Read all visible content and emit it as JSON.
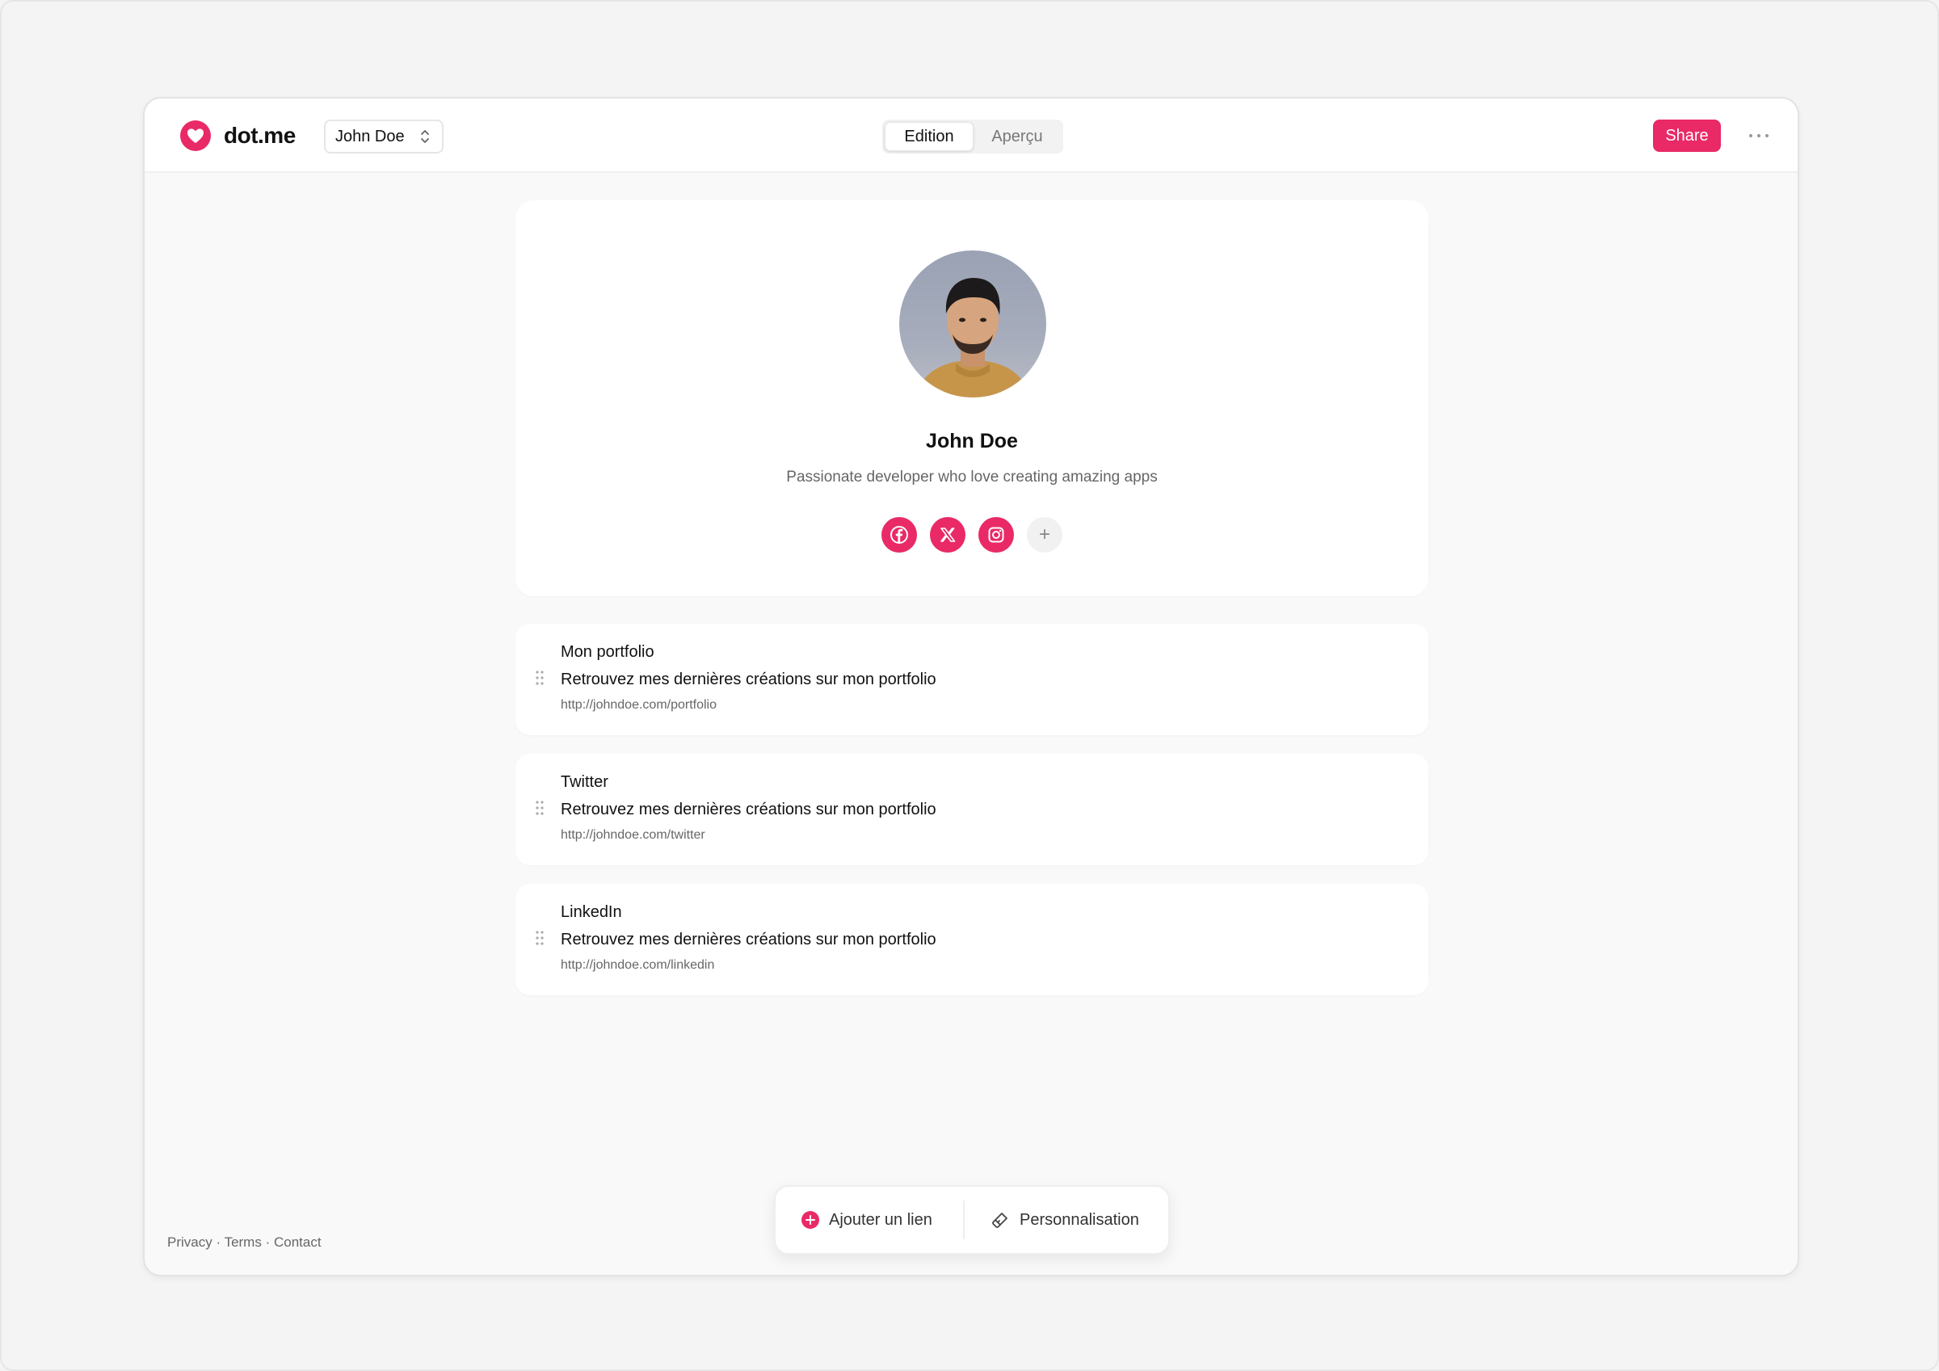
{
  "brand": {
    "name": "dot.me",
    "accent": "#e92a67"
  },
  "header": {
    "profile_select": "John Doe",
    "tabs": [
      {
        "label": "Edition",
        "active": true
      },
      {
        "label": "Aperçu",
        "active": false
      }
    ],
    "share_label": "Share",
    "more_icon": "ellipsis-icon"
  },
  "profile": {
    "name": "John Doe",
    "bio": "Passionate developer who love creating amazing apps",
    "socials": [
      {
        "icon": "facebook-icon"
      },
      {
        "icon": "x-icon"
      },
      {
        "icon": "instagram-icon"
      },
      {
        "icon": "plus-icon",
        "label": "+"
      }
    ]
  },
  "links": [
    {
      "title": "Mon portfolio",
      "description": "Retrouvez mes dernières créations sur mon portfolio",
      "url": "http://johndoe.com/portfolio"
    },
    {
      "title": "Twitter",
      "description": "Retrouvez mes dernières créations sur mon portfolio",
      "url": "http://johndoe.com/twitter"
    },
    {
      "title": "LinkedIn",
      "description": "Retrouvez mes dernières créations sur mon portfolio",
      "url": "http://johndoe.com/linkedin"
    }
  ],
  "footer": {
    "privacy": "Privacy",
    "terms": "Terms",
    "contact": "Contact",
    "separator": "·"
  },
  "toolbar": {
    "add_link": "Ajouter un lien",
    "customize": "Personnalisation"
  }
}
